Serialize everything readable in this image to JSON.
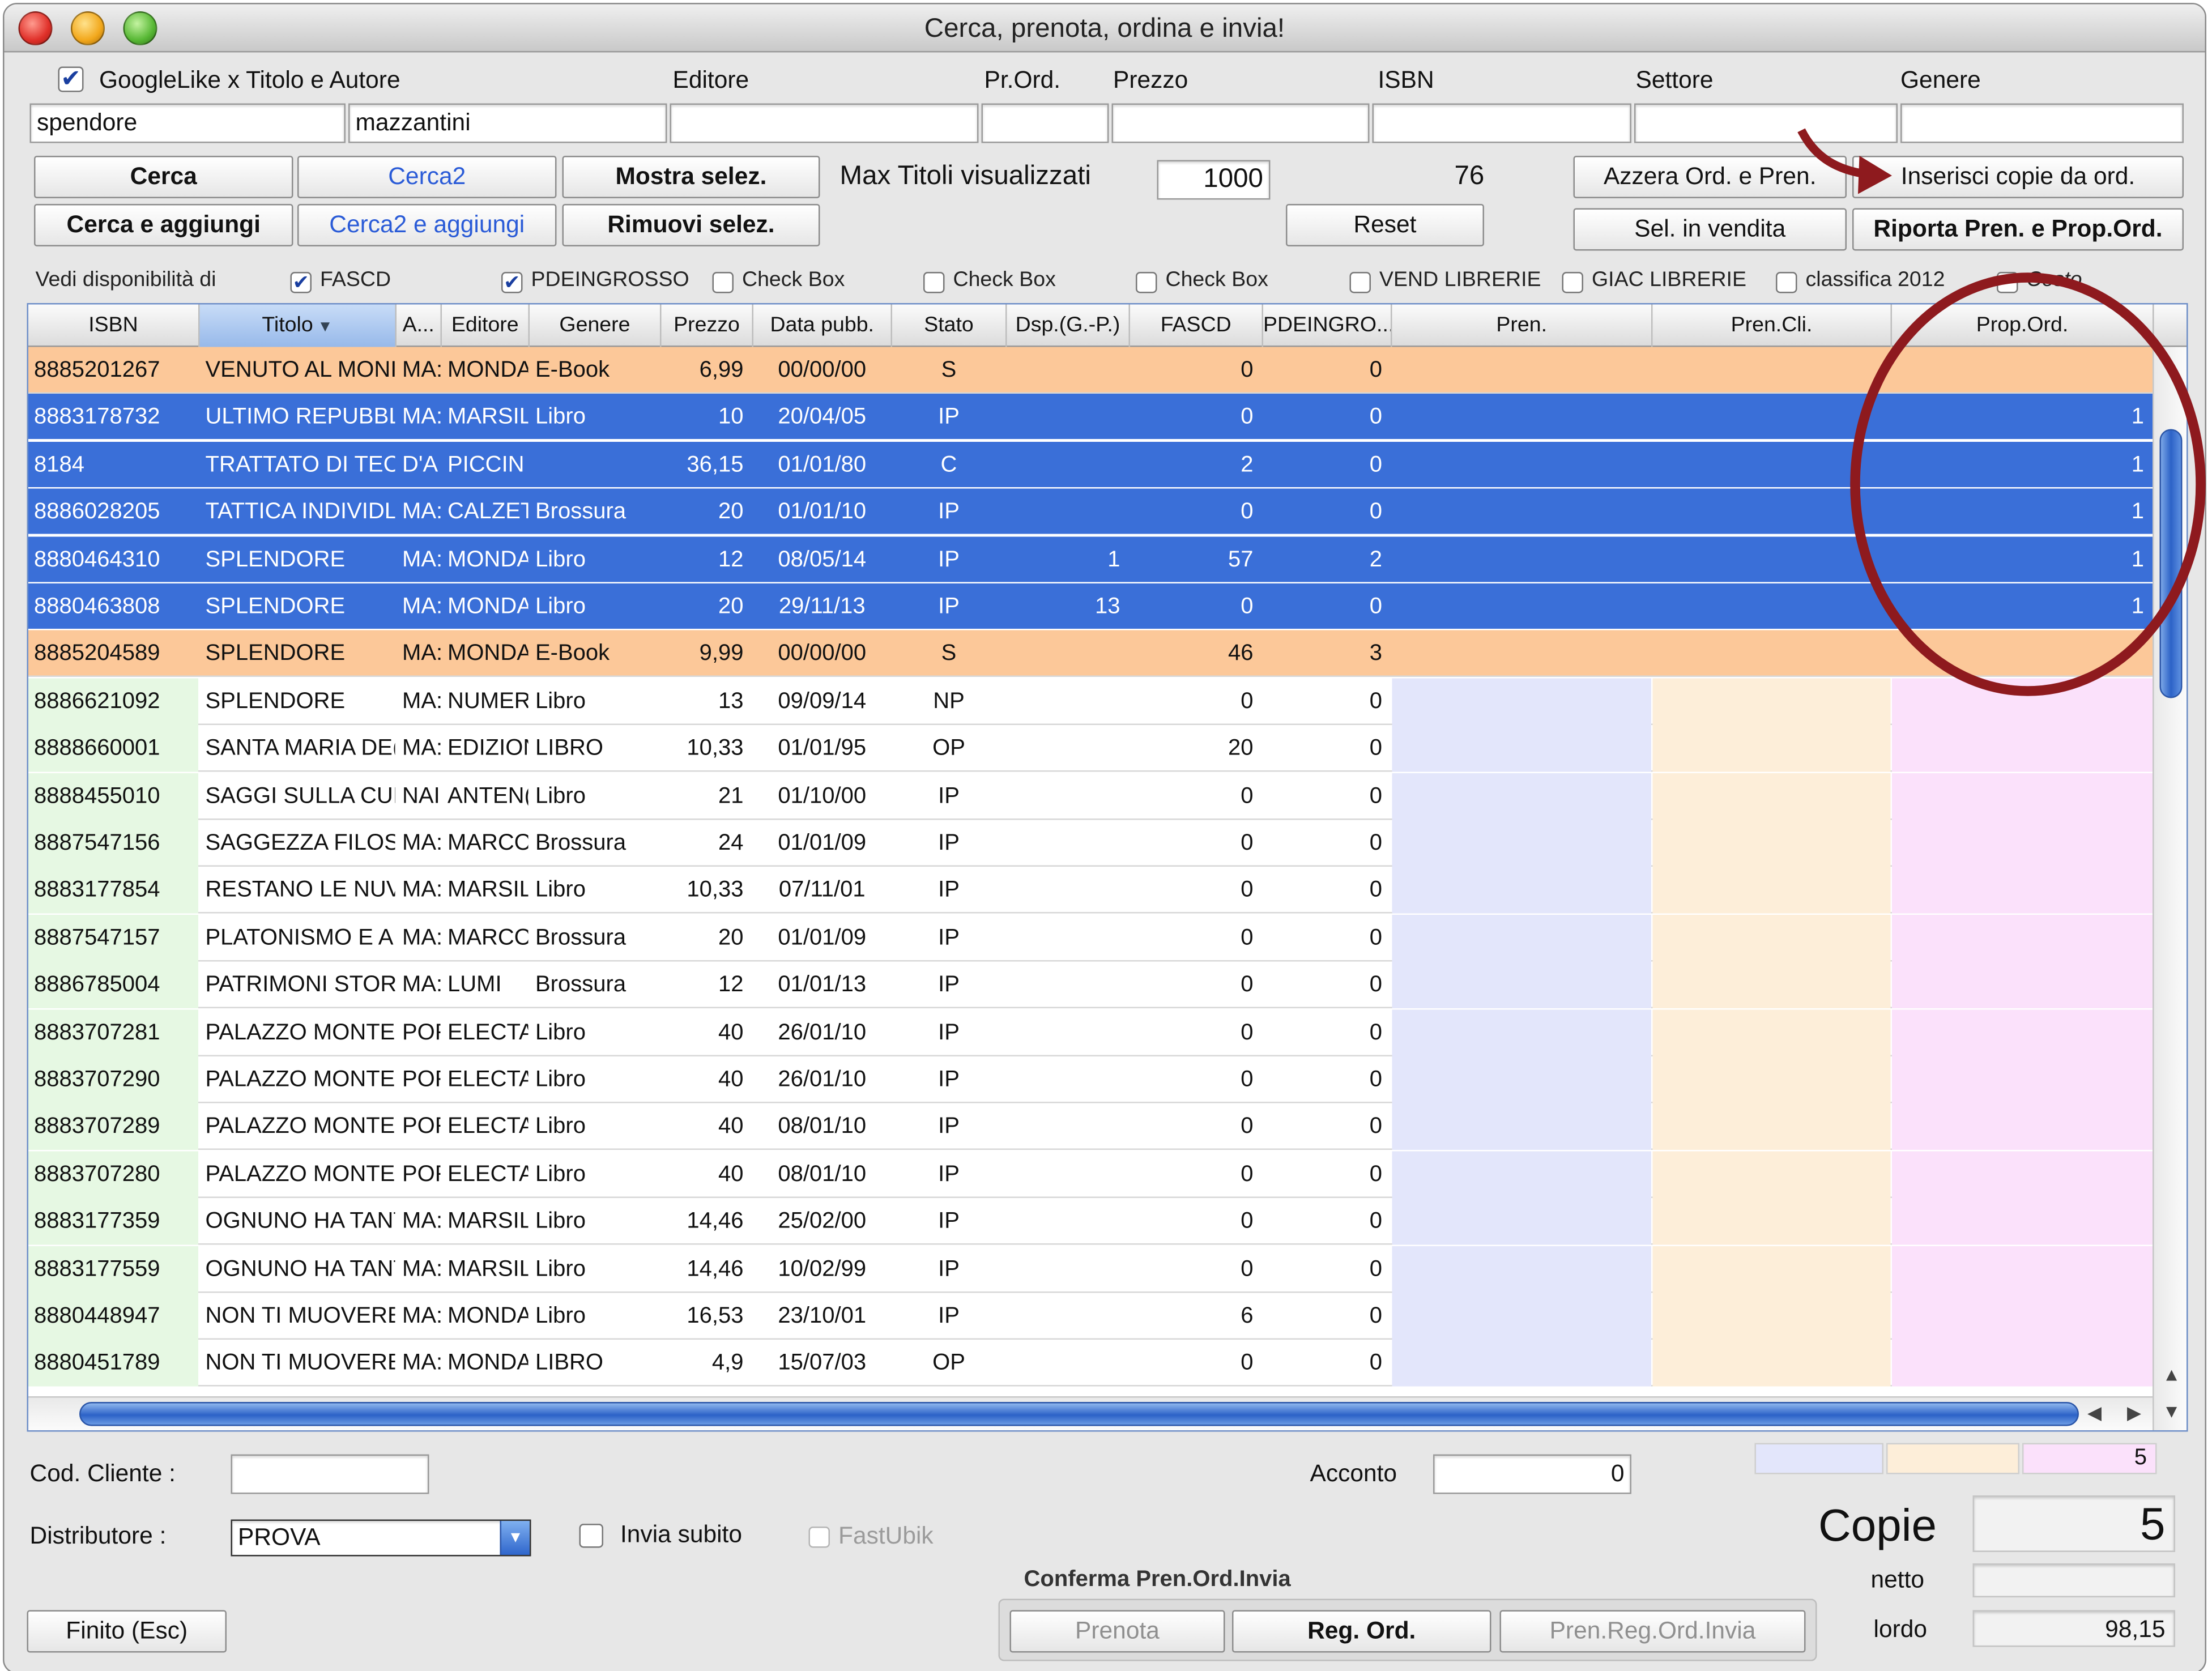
{
  "window": {
    "title": "Cerca, prenota, ordina e invia!"
  },
  "search": {
    "googlelike_label": "GoogleLike x Titolo e Autore",
    "googlelike_checked": true,
    "labels": {
      "editore": "Editore",
      "prord": "Pr.Ord.",
      "prezzo": "Prezzo",
      "isbn": "ISBN",
      "settore": "Settore",
      "genere": "Genere"
    },
    "titolo_value": "spendore",
    "autore_value": "mazzantini",
    "editore_value": "",
    "prord_value": "",
    "prezzo_value": "",
    "isbn_value": "",
    "settore_value": "",
    "genere_value": ""
  },
  "buttons": {
    "cerca": "Cerca",
    "cerca2": "Cerca2",
    "mostra": "Mostra selez.",
    "cerca_agg": "Cerca e aggiungi",
    "cerca2_agg": "Cerca2 e aggiungi",
    "rimuovi": "Rimuovi selez.",
    "reset": "Reset",
    "azzera": "Azzera Ord. e Pren.",
    "inserisci": "Inserisci copie da ord.",
    "sel_vendita": "Sel. in vendita",
    "riporta": "Riporta Pren. e Prop.Ord.",
    "finito": "Finito (Esc)",
    "prenota": "Prenota",
    "reg_ord": "Reg. Ord.",
    "pren_reg": "Pren.Reg.Ord.Invia"
  },
  "max_titoli": {
    "label": "Max Titoli visualizzati",
    "value": "1000",
    "count": "76"
  },
  "disponibilita": {
    "label": "Vedi disponibilità di",
    "options": [
      {
        "label": "FASCD",
        "checked": true
      },
      {
        "label": "PDEINGROSSO",
        "checked": true
      },
      {
        "label": "Check Box",
        "checked": false
      },
      {
        "label": "Check Box",
        "checked": false
      },
      {
        "label": "Check Box",
        "checked": false
      },
      {
        "label": "VEND LIBRERIE",
        "checked": false
      },
      {
        "label": "GIAC LIBRERIE",
        "checked": false
      },
      {
        "label": "classifica 2012",
        "checked": false
      },
      {
        "label": "Costo",
        "checked": false
      }
    ]
  },
  "table": {
    "columns": [
      "ISBN",
      "Titolo",
      "A...",
      "Editore",
      "Genere",
      "Prezzo",
      "Data pubb.",
      "Stato",
      "Dsp.(G.-P.)",
      "FASCD",
      "PDEINGRO...",
      "Pren.",
      "Pren.Cli.",
      "Prop.Ord."
    ],
    "rows": [
      {
        "isbn": "8885201267",
        "titolo": "VENUTO AL MONI",
        "autore": "MA:",
        "editore": "MONDA",
        "genere": "E-Book",
        "prezzo": "6,99",
        "data": "00/00/00",
        "stato": "S",
        "dsp": "",
        "fascd": "0",
        "pde": "0",
        "pren": "",
        "prencli": "",
        "propord": "",
        "style": "orange"
      },
      {
        "isbn": "8883178732",
        "titolo": "ULTIMO REPUBBLI",
        "autore": "MA:",
        "editore": "MARSILI",
        "genere": "Libro",
        "prezzo": "10",
        "data": "20/04/05",
        "stato": "IP",
        "dsp": "",
        "fascd": "0",
        "pde": "0",
        "pren": "",
        "prencli": "",
        "propord": "1",
        "style": "sel"
      },
      {
        "isbn": "8184",
        "titolo": "TRATTATO DI TEC",
        "autore": "D'A",
        "editore": "PICCIN",
        "genere": "",
        "prezzo": "36,15",
        "data": "01/01/80",
        "stato": "C",
        "dsp": "",
        "fascd": "2",
        "pde": "0",
        "pren": "",
        "prencli": "",
        "propord": "1",
        "style": "sel"
      },
      {
        "isbn": "8886028205",
        "titolo": "TATTICA INDIVIDL",
        "autore": "MA:",
        "editore": "CALZET",
        "genere": "Brossura",
        "prezzo": "20",
        "data": "01/01/10",
        "stato": "IP",
        "dsp": "",
        "fascd": "0",
        "pde": "0",
        "pren": "",
        "prencli": "",
        "propord": "1",
        "style": "sel"
      },
      {
        "isbn": "8880464310",
        "titolo": "SPLENDORE",
        "autore": "MA:",
        "editore": "MONDA",
        "genere": "Libro",
        "prezzo": "12",
        "data": "08/05/14",
        "stato": "IP",
        "dsp": "1",
        "fascd": "57",
        "pde": "2",
        "pren": "",
        "prencli": "",
        "propord": "1",
        "style": "sel"
      },
      {
        "isbn": "8880463808",
        "titolo": "SPLENDORE",
        "autore": "MA:",
        "editore": "MONDA",
        "genere": "Libro",
        "prezzo": "20",
        "data": "29/11/13",
        "stato": "IP",
        "dsp": "13",
        "fascd": "0",
        "pde": "0",
        "pren": "",
        "prencli": "",
        "propord": "1",
        "style": "sel"
      },
      {
        "isbn": "8885204589",
        "titolo": "SPLENDORE",
        "autore": "MA:",
        "editore": "MONDA",
        "genere": "E-Book",
        "prezzo": "9,99",
        "data": "00/00/00",
        "stato": "S",
        "dsp": "",
        "fascd": "46",
        "pde": "3",
        "pren": "",
        "prencli": "",
        "propord": "",
        "style": "orange"
      },
      {
        "isbn": "8886621092",
        "titolo": "SPLENDORE",
        "autore": "MA:",
        "editore": "NUMERI",
        "genere": "Libro",
        "prezzo": "13",
        "data": "09/09/14",
        "stato": "NP",
        "dsp": "",
        "fascd": "0",
        "pde": "0",
        "pren": "",
        "prencli": "",
        "propord": "",
        "style": "norm"
      },
      {
        "isbn": "8888660001",
        "titolo": "SANTA MARIA DE(",
        "autore": "MA:",
        "editore": "EDIZION",
        "genere": "LIBRO",
        "prezzo": "10,33",
        "data": "01/01/95",
        "stato": "OP",
        "dsp": "",
        "fascd": "20",
        "pde": "0",
        "pren": "",
        "prencli": "",
        "propord": "",
        "style": "norm"
      },
      {
        "isbn": "8888455010",
        "titolo": "SAGGI SULLA CUL",
        "autore": "NAI",
        "editore": "ANTEN(",
        "genere": "Libro",
        "prezzo": "21",
        "data": "01/10/00",
        "stato": "IP",
        "dsp": "",
        "fascd": "0",
        "pde": "0",
        "pren": "",
        "prencli": "",
        "propord": "",
        "style": "norm"
      },
      {
        "isbn": "8887547156",
        "titolo": "SAGGEZZA FILOSC",
        "autore": "MA:",
        "editore": "MARCO",
        "genere": "Brossura",
        "prezzo": "24",
        "data": "01/01/09",
        "stato": "IP",
        "dsp": "",
        "fascd": "0",
        "pde": "0",
        "pren": "",
        "prencli": "",
        "propord": "",
        "style": "norm"
      },
      {
        "isbn": "8883177854",
        "titolo": "RESTANO LE NUV(",
        "autore": "MA:",
        "editore": "MARSILI",
        "genere": "Libro",
        "prezzo": "10,33",
        "data": "07/11/01",
        "stato": "IP",
        "dsp": "",
        "fascd": "0",
        "pde": "0",
        "pren": "",
        "prencli": "",
        "propord": "",
        "style": "norm"
      },
      {
        "isbn": "8887547157",
        "titolo": "PLATONISMO E AI",
        "autore": "MA:",
        "editore": "MARCO",
        "genere": "Brossura",
        "prezzo": "20",
        "data": "01/01/09",
        "stato": "IP",
        "dsp": "",
        "fascd": "0",
        "pde": "0",
        "pren": "",
        "prencli": "",
        "propord": "",
        "style": "norm"
      },
      {
        "isbn": "8886785004",
        "titolo": "PATRIMONI STORI",
        "autore": "MA:",
        "editore": "LUMI",
        "genere": "Brossura",
        "prezzo": "12",
        "data": "01/01/13",
        "stato": "IP",
        "dsp": "",
        "fascd": "0",
        "pde": "0",
        "pren": "",
        "prencli": "",
        "propord": "",
        "style": "norm"
      },
      {
        "isbn": "8883707281",
        "titolo": "PALAZZO MONTE(",
        "autore": "POF",
        "editore": "ELECTA",
        "genere": "Libro",
        "prezzo": "40",
        "data": "26/01/10",
        "stato": "IP",
        "dsp": "",
        "fascd": "0",
        "pde": "0",
        "pren": "",
        "prencli": "",
        "propord": "",
        "style": "norm"
      },
      {
        "isbn": "8883707290",
        "titolo": "PALAZZO MONTE(",
        "autore": "POF",
        "editore": "ELECTA",
        "genere": "Libro",
        "prezzo": "40",
        "data": "26/01/10",
        "stato": "IP",
        "dsp": "",
        "fascd": "0",
        "pde": "0",
        "pren": "",
        "prencli": "",
        "propord": "",
        "style": "norm"
      },
      {
        "isbn": "8883707289",
        "titolo": "PALAZZO MONTE(",
        "autore": "POF",
        "editore": "ELECTA",
        "genere": "Libro",
        "prezzo": "40",
        "data": "08/01/10",
        "stato": "IP",
        "dsp": "",
        "fascd": "0",
        "pde": "0",
        "pren": "",
        "prencli": "",
        "propord": "",
        "style": "norm"
      },
      {
        "isbn": "8883707280",
        "titolo": "PALAZZO MONTE(",
        "autore": "POF",
        "editore": "ELECTA",
        "genere": "Libro",
        "prezzo": "40",
        "data": "08/01/10",
        "stato": "IP",
        "dsp": "",
        "fascd": "0",
        "pde": "0",
        "pren": "",
        "prencli": "",
        "propord": "",
        "style": "norm"
      },
      {
        "isbn": "8883177359",
        "titolo": "OGNUNO HA TANT",
        "autore": "MA:",
        "editore": "MARSILI",
        "genere": "Libro",
        "prezzo": "14,46",
        "data": "25/02/00",
        "stato": "IP",
        "dsp": "",
        "fascd": "0",
        "pde": "0",
        "pren": "",
        "prencli": "",
        "propord": "",
        "style": "norm"
      },
      {
        "isbn": "8883177559",
        "titolo": "OGNUNO HA TANT",
        "autore": "MA:",
        "editore": "MARSILI",
        "genere": "Libro",
        "prezzo": "14,46",
        "data": "10/02/99",
        "stato": "IP",
        "dsp": "",
        "fascd": "0",
        "pde": "0",
        "pren": "",
        "prencli": "",
        "propord": "",
        "style": "norm"
      },
      {
        "isbn": "8880448947",
        "titolo": "NON TI MUOVERE",
        "autore": "MA:",
        "editore": "MONDA",
        "genere": "Libro",
        "prezzo": "16,53",
        "data": "23/10/01",
        "stato": "IP",
        "dsp": "",
        "fascd": "6",
        "pde": "0",
        "pren": "",
        "prencli": "",
        "propord": "",
        "style": "norm"
      },
      {
        "isbn": "8880451789",
        "titolo": "NON TI MUOVERE",
        "autore": "MA:",
        "editore": "MONDA",
        "genere": "LIBRO",
        "prezzo": "4,9",
        "data": "15/07/03",
        "stato": "OP",
        "dsp": "",
        "fascd": "0",
        "pde": "0",
        "pren": "",
        "prencli": "",
        "propord": "",
        "style": "norm"
      }
    ]
  },
  "footer": {
    "cod_cliente_label": "Cod. Cliente :",
    "cod_cliente_value": "",
    "distributore_label": "Distributore :",
    "distributore_value": "PROVA",
    "invia_subito": "Invia subito",
    "fastubik": "FastUbik",
    "acconto_label": "Acconto",
    "acconto_value": "0",
    "totals_prop": "5",
    "copie_label": "Copie",
    "copie_value": "5",
    "netto_label": "netto",
    "netto_value": "",
    "lordo_label": "lordo",
    "lordo_value": "98,15",
    "conferma_label": "Conferma Pren.Ord.Invia"
  },
  "colors": {
    "selected_row": "#3a6fd8",
    "orange_row": "#fcc899",
    "isbn_green": "#e6f8e3",
    "pren_col": "#e3e6fb",
    "prencli_col": "#fdeed9",
    "propord_col": "#fbe1fb",
    "annotation_red": "#8e1a1e"
  },
  "icons": {
    "sort": "sort-down-icon",
    "dropdown": "chevron-down-icon",
    "annotation": "curved-arrow-icon"
  }
}
